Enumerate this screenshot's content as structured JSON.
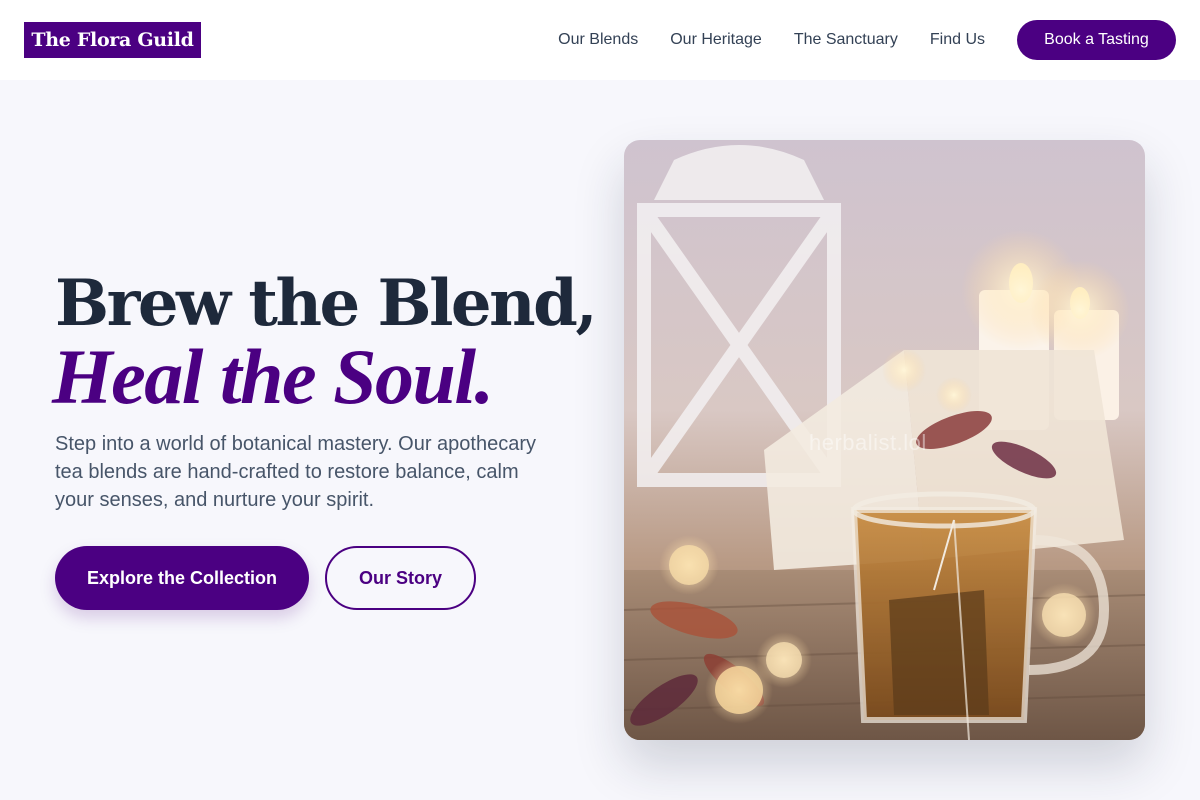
{
  "nav": {
    "logo": "The Flora Guild",
    "links": [
      "Our Blends",
      "Our Heritage",
      "The Sanctuary",
      "Find Us"
    ],
    "cta": "Book a Tasting"
  },
  "hero": {
    "headline_line1": "Brew the Blend,",
    "headline_line2": "Heal the Soul.",
    "subtitle": "Step into a world of botanical mastery. Our apothecary tea blends are hand-crafted to restore balance, calm your senses, and nurture your spirit.",
    "primary_button": "Explore the Collection",
    "secondary_button": "Our Story",
    "image_watermark": "herbalist.lol"
  },
  "colors": {
    "brand": "#4b0082",
    "heading": "#1e293b",
    "body_text": "#475569",
    "page_background": "#f7f7fc"
  }
}
